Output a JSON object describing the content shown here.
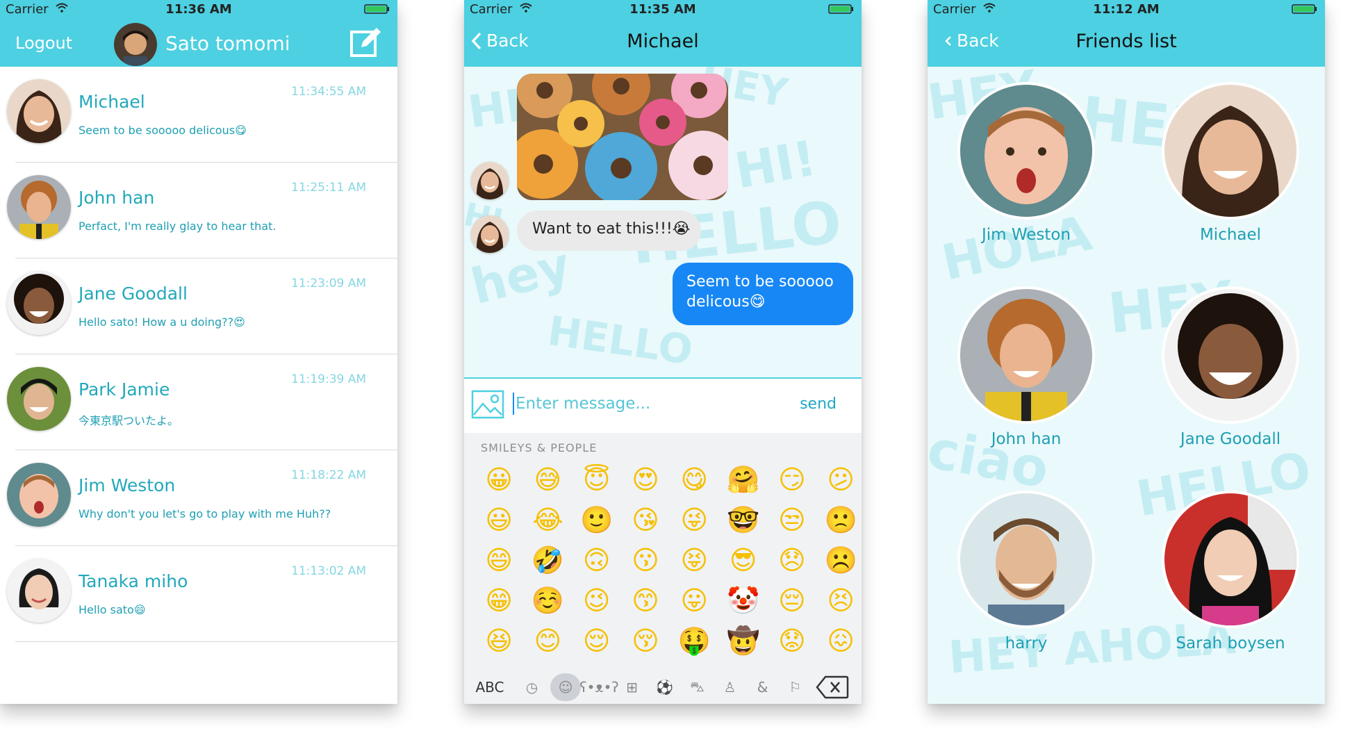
{
  "status": {
    "carrier": "Carrier",
    "times": [
      "11:36 AM",
      "11:35 AM",
      "11:12 AM"
    ]
  },
  "chats_screen": {
    "logout_label": "Logout",
    "user_name": "Sato tomomi",
    "compose_icon": "compose-icon",
    "chats": [
      {
        "name": "Michael",
        "preview": "Seem to be sooooo delicous😋",
        "time": "11:34:55 AM"
      },
      {
        "name": "John han",
        "preview": "Perfact, I'm really glay to hear that.",
        "time": "11:25:11 AM"
      },
      {
        "name": "Jane Goodall",
        "preview": "Hello sato! How a u doing??😍",
        "time": "11:23:09 AM"
      },
      {
        "name": "Park Jamie",
        "preview": "今東京駅ついたよ。",
        "time": "11:19:39 AM"
      },
      {
        "name": "Jim Weston",
        "preview": "Why don't you let's go to play with me Huh??",
        "time": "11:18:22 AM"
      },
      {
        "name": "Tanaka miho",
        "preview": "Hello sato😄",
        "time": "11:13:02 AM"
      }
    ]
  },
  "conversation_screen": {
    "back_label": "Back",
    "title": "Michael",
    "messages": {
      "incoming_text": "Want to eat this!!!😭",
      "outgoing_text": "Seem to be sooooo delicous😋"
    },
    "composer": {
      "placeholder": "Enter message...",
      "send_label": "send"
    },
    "keyboard": {
      "category": "SMILEYS & PEOPLE",
      "abc_label": "ABC",
      "emojis": [
        "😀",
        "😅",
        "😇",
        "😍",
        "😋",
        "🤗",
        "😏",
        "😕",
        "😃",
        "😂",
        "🙂",
        "😘",
        "😜",
        "🤓",
        "😒",
        "🙁",
        "😄",
        "🤣",
        "🙃",
        "😗",
        "😝",
        "😎",
        "😞",
        "☹️",
        "😁",
        "☺️",
        "😉",
        "😙",
        "😛",
        "🤡",
        "😔",
        "😣",
        "😆",
        "😊",
        "😌",
        "😚",
        "🤑",
        "🤠",
        "😟",
        "😖"
      ],
      "tab_icons": [
        "clock-icon",
        "smiley-icon",
        "bear-icon",
        "food-icon",
        "ball-icon",
        "car-icon",
        "bulb-icon",
        "symbols-icon",
        "flag-icon"
      ]
    }
  },
  "friends_screen": {
    "back_label": "Back",
    "title": "Friends list",
    "friends": [
      "Jim Weston",
      "Michael",
      "John han",
      "Jane Goodall",
      "harry",
      "Sarah boysen"
    ]
  },
  "colors": {
    "accent": "#4dd0e1",
    "text_teal": "#1e9fb3",
    "bubble_blue": "#1787f5",
    "bubble_gray": "#eaeaea"
  }
}
